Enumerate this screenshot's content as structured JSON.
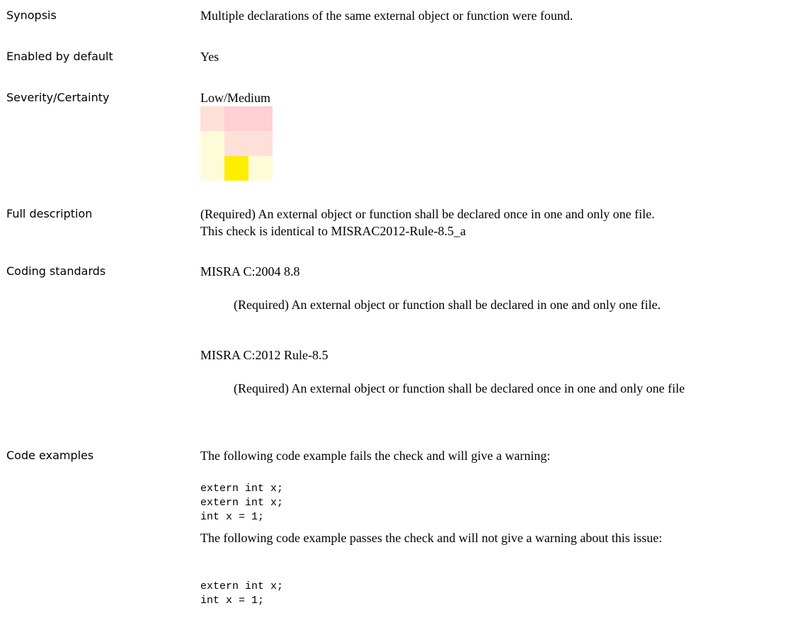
{
  "synopsis": {
    "label": "Synopsis",
    "text": "Multiple declarations of the same external object or function were found."
  },
  "enabled": {
    "label": "Enabled by default",
    "text": "Yes"
  },
  "severity": {
    "label": "Severity/Certainty",
    "text": "Low/Medium",
    "matrix_colors": [
      [
        "#fde1d8",
        "#fdd0d3",
        "#fdd0d3"
      ],
      [
        "#fefcd8",
        "#fde1d8",
        "#fde1d8"
      ],
      [
        "#fefcd8",
        "#ffee00",
        "#fefcd8"
      ]
    ]
  },
  "full_description": {
    "label": "Full description",
    "line1": "(Required) An external object or function shall be declared once in one and only one file.",
    "line2": "This check is identical to MISRAC2012-Rule-8.5_a"
  },
  "coding_standards": {
    "label": "Coding standards",
    "items": [
      {
        "name": "MISRA C:2004 8.8",
        "description": "(Required) An external object or function shall be declared in one and only one file."
      },
      {
        "name": "MISRA C:2012 Rule-8.5",
        "description": "(Required) An external object or function shall be declared once in one and only one file"
      }
    ]
  },
  "code_examples": {
    "label": "Code examples",
    "fail_intro": "The following code example fails the check and will give a warning:",
    "fail_code": "extern int x;\nextern int x;\nint x = 1;",
    "pass_intro": "The following code example passes the check and will not give a warning about this issue:",
    "pass_code": "extern int x;\nint x = 1;"
  }
}
